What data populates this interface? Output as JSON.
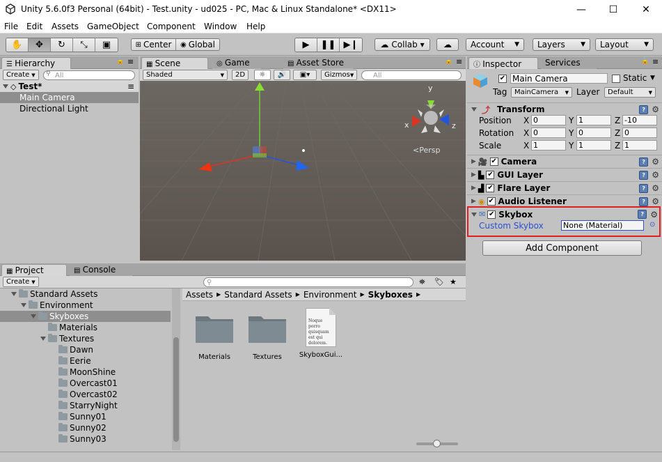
{
  "window": {
    "title": "Unity 5.6.0f3 Personal (64bit) - Test.unity - ud025 - PC, Mac & Linux Standalone* <DX11>",
    "minimize": "—",
    "maximize": "☐",
    "close": "✕"
  },
  "menu": [
    "File",
    "Edit",
    "Assets",
    "GameObject",
    "Component",
    "Window",
    "Help"
  ],
  "toolbar": {
    "tools": [
      "hand-icon",
      "move-icon",
      "rotate-icon",
      "scale-icon",
      "rect-icon"
    ],
    "pivot": "Center",
    "space": "Global",
    "collab": "Collab ▾",
    "account": "Account",
    "layers": "Layers",
    "layout": "Layout"
  },
  "hierarchy": {
    "tab": "Hierarchy",
    "create": "Create",
    "search_placeholder": "All",
    "scene": "Test*",
    "items": [
      "Main Camera",
      "Directional Light"
    ]
  },
  "scene": {
    "tabs": [
      "Scene",
      "Game",
      "Asset Store"
    ],
    "shading": "Shaded",
    "mode2d": "2D",
    "gizmos": "Gizmos",
    "search_placeholder": "All",
    "persp": "Persp",
    "axis_y": "y",
    "axis_x": "x",
    "axis_z": "z"
  },
  "inspector": {
    "tabs": [
      "Inspector",
      "Services"
    ],
    "name": "Main Camera",
    "static": "Static",
    "tag_label": "Tag",
    "tag": "MainCamera",
    "layer_label": "Layer",
    "layer": "Default",
    "transform": {
      "title": "Transform",
      "rows": [
        {
          "label": "Position",
          "x": "0",
          "y": "1",
          "z": "-10"
        },
        {
          "label": "Rotation",
          "x": "0",
          "y": "0",
          "z": "0"
        },
        {
          "label": "Scale",
          "x": "1",
          "y": "1",
          "z": "1"
        }
      ]
    },
    "components": [
      "Camera",
      "GUI Layer",
      "Flare Layer",
      "Audio Listener"
    ],
    "skybox": {
      "title": "Skybox",
      "label": "Custom Skybox",
      "value": "None (Material)"
    },
    "add_component": "Add Component"
  },
  "project": {
    "tabs": [
      "Project",
      "Console"
    ],
    "create": "Create",
    "tree": [
      {
        "label": "Standard Assets",
        "depth": 1,
        "open": true
      },
      {
        "label": "Environment",
        "depth": 2,
        "open": true
      },
      {
        "label": "Skyboxes",
        "depth": 3,
        "open": true,
        "selected": true
      },
      {
        "label": "Materials",
        "depth": 4
      },
      {
        "label": "Textures",
        "depth": 4,
        "open": true
      },
      {
        "label": "Dawn",
        "depth": 5
      },
      {
        "label": "Eerie",
        "depth": 5
      },
      {
        "label": "MoonShine",
        "depth": 5
      },
      {
        "label": "Overcast01",
        "depth": 5
      },
      {
        "label": "Overcast02",
        "depth": 5
      },
      {
        "label": "StarryNight",
        "depth": 5
      },
      {
        "label": "Sunny01",
        "depth": 5
      },
      {
        "label": "Sunny02",
        "depth": 5
      },
      {
        "label": "Sunny03",
        "depth": 5
      }
    ],
    "breadcrumb": [
      "Assets",
      "Standard Assets",
      "Environment",
      "Skyboxes"
    ],
    "assets": [
      "Materials",
      "Textures",
      "SkyboxGui..."
    ],
    "doc_text": "Noque porro quisquam est qui dolorem."
  }
}
